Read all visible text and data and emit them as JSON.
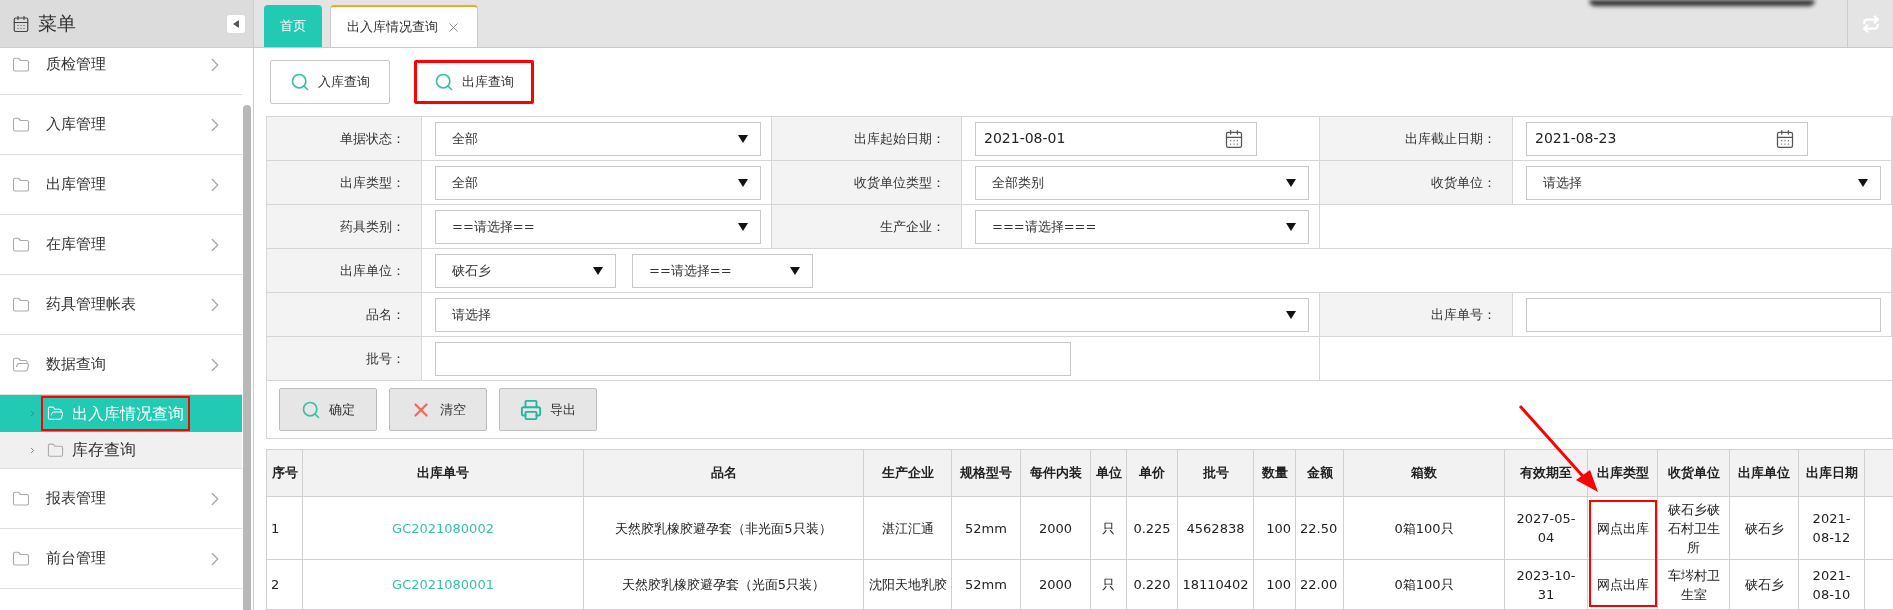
{
  "sidebar": {
    "title": "菜单",
    "items": [
      {
        "label": "质检管理",
        "expanded": false
      },
      {
        "label": "入库管理",
        "expanded": false
      },
      {
        "label": "出库管理",
        "expanded": false
      },
      {
        "label": "在库管理",
        "expanded": false
      },
      {
        "label": "药具管理帐表",
        "expanded": false
      },
      {
        "label": "数据查询",
        "expanded": true,
        "children": [
          {
            "label": "出入库情况查询",
            "selected": true,
            "highlighted": true
          },
          {
            "label": "库存查询",
            "selected": false,
            "highlighted": false
          }
        ]
      },
      {
        "label": "报表管理",
        "expanded": false
      },
      {
        "label": "前台管理",
        "expanded": false
      }
    ]
  },
  "tabs": [
    {
      "label": "首页",
      "selected": false,
      "closable": false
    },
    {
      "label": "出入库情况查询",
      "selected": true,
      "closable": true
    }
  ],
  "query_buttons": [
    {
      "label": "入库查询",
      "highlighted": false
    },
    {
      "label": "出库查询",
      "highlighted": true
    }
  ],
  "form": {
    "rows": [
      {
        "fields": [
          {
            "label": "单据状态：",
            "controls": [
              {
                "kind": "select",
                "value": "全部"
              }
            ]
          },
          {
            "label": "出库起始日期：",
            "controls": [
              {
                "kind": "date",
                "value": "2021-08-01"
              }
            ]
          },
          {
            "label": "出库截止日期：",
            "controls": [
              {
                "kind": "date",
                "value": "2021-08-23"
              }
            ]
          }
        ]
      },
      {
        "fields": [
          {
            "label": "出库类型：",
            "controls": [
              {
                "kind": "select",
                "value": "全部"
              }
            ]
          },
          {
            "label": "收货单位类型：",
            "controls": [
              {
                "kind": "select",
                "value": "全部类别"
              }
            ]
          },
          {
            "label": "收货单位：",
            "controls": [
              {
                "kind": "select",
                "value": "请选择"
              }
            ]
          }
        ]
      },
      {
        "fields": [
          {
            "label": "药具类别：",
            "controls": [
              {
                "kind": "select",
                "value": "==请选择=="
              }
            ]
          },
          {
            "label": "生产企业：",
            "controls": [
              {
                "kind": "select",
                "value": "===请选择==="
              }
            ]
          }
        ]
      },
      {
        "fields": [
          {
            "label": "出库单位：",
            "controls": [
              {
                "kind": "select",
                "value": "硖石乡"
              },
              {
                "kind": "select",
                "value": "==请选择=="
              }
            ]
          }
        ]
      },
      {
        "fields": [
          {
            "label": "品名：",
            "controls": [
              {
                "kind": "select",
                "value": "请选择"
              }
            ]
          },
          {
            "label": "出库单号：",
            "controls": [
              {
                "kind": "text"
              }
            ]
          }
        ]
      },
      {
        "fields": [
          {
            "label": "批号：",
            "controls": [
              {
                "kind": "text"
              }
            ]
          }
        ]
      }
    ]
  },
  "action_buttons": [
    {
      "label": "确定",
      "kind": "search"
    },
    {
      "label": "清空",
      "kind": "clear"
    },
    {
      "label": "导出",
      "kind": "print"
    }
  ],
  "table": {
    "columns": [
      {
        "label": "序号",
        "highlighted": false
      },
      {
        "label": "出库单号",
        "highlighted": false
      },
      {
        "label": "品名",
        "highlighted": false
      },
      {
        "label": "生产企业",
        "highlighted": false
      },
      {
        "label": "规格型号",
        "highlighted": false
      },
      {
        "label": "每件内装",
        "highlighted": false
      },
      {
        "label": "单位",
        "highlighted": false
      },
      {
        "label": "单价",
        "highlighted": false
      },
      {
        "label": "批号",
        "highlighted": false
      },
      {
        "label": "数量",
        "highlighted": false
      },
      {
        "label": "金额",
        "highlighted": false
      },
      {
        "label": "箱数",
        "highlighted": false
      },
      {
        "label": "有效期至",
        "highlighted": false
      },
      {
        "label": "出库类型",
        "highlighted": true
      },
      {
        "label": "收货单位",
        "highlighted": false
      },
      {
        "label": "出库单位",
        "highlighted": false
      },
      {
        "label": "出库日期",
        "highlighted": false
      }
    ],
    "rows": [
      {
        "cells": [
          "1",
          "GC2021080002",
          "天然胶乳橡胶避孕套（非光面5只装）",
          "湛江汇通",
          "52mm",
          "2000",
          "只",
          "0.225",
          "4562838",
          "100",
          "22.50",
          "0箱100只",
          "2027-05-04",
          "网点出库",
          "硖石乡硖石村卫生所",
          "硖石乡",
          "2021-08-12"
        ]
      },
      {
        "cells": [
          "2",
          "GC2021080001",
          "天然胶乳橡胶避孕套（光面5只装）",
          "沈阳天地乳胶",
          "52mm",
          "2000",
          "只",
          "0.220",
          "18110402",
          "100",
          "22.00",
          "0箱100只",
          "2023-10-31",
          "网点出库",
          "车埁村卫生室",
          "硖石乡",
          "2021-08-10"
        ]
      }
    ]
  }
}
